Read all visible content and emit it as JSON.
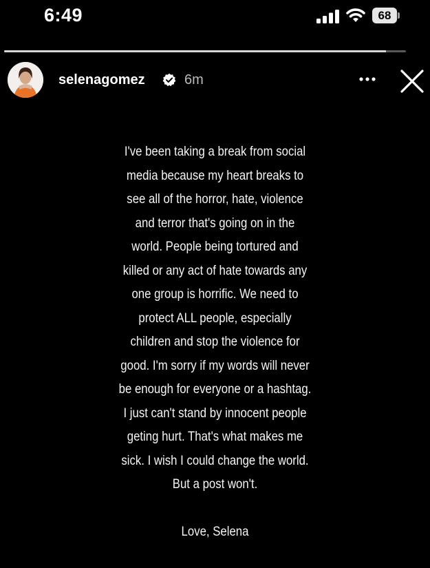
{
  "status_bar": {
    "time": "6:49",
    "battery_level": "68",
    "icons": [
      "signal-icon",
      "wifi-icon",
      "battery-icon"
    ]
  },
  "story": {
    "progress": 0.95,
    "username": "selenagomez",
    "verified": true,
    "timestamp": "6m",
    "avatar_icon": "profile-photo",
    "more_icon": "more-horizontal-icon",
    "close_icon": "close-icon",
    "text_color": "#f5f5f5",
    "background": "#000000",
    "lines": [
      "I've been taking a break from social",
      "media because my heart breaks to",
      "see all of the horror, hate, violence",
      "and terror that's going on in the",
      "world. People being tortured and",
      "killed or any act of hate towards any",
      "one group is horrific. We need to",
      "protect ALL people, especially",
      "children and stop the violence for",
      "good.  I'm sorry if my words will never",
      "be enough for everyone or a hashtag.",
      "I just can't stand by innocent people",
      "geting hurt. That's what makes me",
      "sick. I wish I could change the world.",
      "But a post won't.",
      "",
      "Love, Selena"
    ]
  }
}
